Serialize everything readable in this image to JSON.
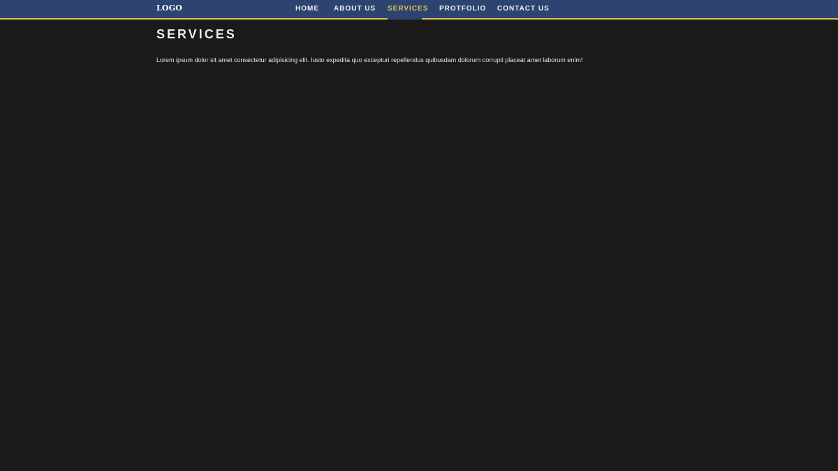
{
  "header": {
    "logo": "LOGO",
    "nav": [
      {
        "label": "HOME",
        "active": false
      },
      {
        "label": "ABOUT US",
        "active": false
      },
      {
        "label": "SERVICES",
        "active": true
      },
      {
        "label": "PROTFOLIO",
        "active": false
      },
      {
        "label": "CONTACT US",
        "active": false
      }
    ],
    "colors": {
      "bar": "#2d4470",
      "accent": "#e2c24e"
    }
  },
  "main": {
    "title": "SERVICES",
    "text": "Lorem ipsum dolor sit amet consectetur adipisicing elit. Iusto expedita quo excepturi repellendus quibusdam dolorum corrupti placeat amet laborum enim!"
  },
  "colors": {
    "background": "#1b1a1b",
    "text": "#ececec"
  }
}
